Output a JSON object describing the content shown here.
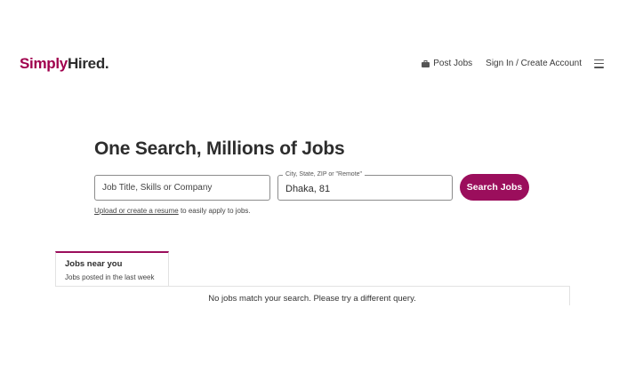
{
  "brand": {
    "part1": "Simply",
    "part2": "Hired",
    "dot": ".",
    "color": "#a0004d"
  },
  "nav": {
    "post_jobs": "Post Jobs",
    "post_jobs_icon": "briefcase-icon",
    "sign_in": "Sign In / Create Account",
    "menu_icon": "hamburger-menu-icon"
  },
  "hero": {
    "title": "One Search, Millions of Jobs"
  },
  "search": {
    "what_placeholder": "Job Title, Skills or Company",
    "what_value": "",
    "where_label": "City, State, ZIP or \"Remote\"",
    "where_value": "Dhaka, 81",
    "button_label": "Search Jobs",
    "button_color": "#9b0e5c"
  },
  "resume": {
    "link_text": "Upload or create a resume",
    "suffix": " to easily apply to jobs."
  },
  "jobs_tab": {
    "title": "Jobs near you",
    "subtitle": "Jobs posted in the last week"
  },
  "results": {
    "message": "No jobs match your search. Please try a different query."
  }
}
